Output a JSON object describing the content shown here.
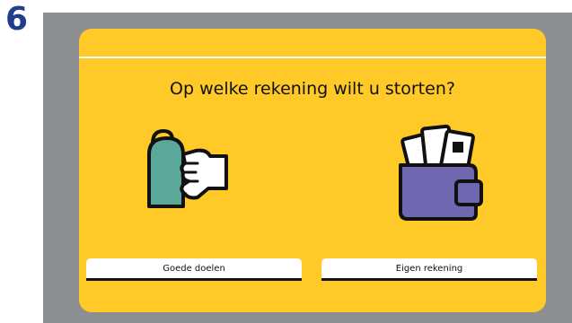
{
  "step": {
    "number": "6"
  },
  "screen": {
    "prompt": "Op welke rekening wilt u storten?",
    "options": [
      {
        "label": "Goede doelen",
        "icon": "charity-collection-box-icon"
      },
      {
        "label": "Eigen rekening",
        "icon": "wallet-icon"
      }
    ]
  },
  "colors": {
    "panel": "#ffc928",
    "frame": "#8c8e90",
    "step_number": "#1f3f8c",
    "box_teal": "#5aa89a",
    "wallet_purple": "#6f68b0"
  }
}
